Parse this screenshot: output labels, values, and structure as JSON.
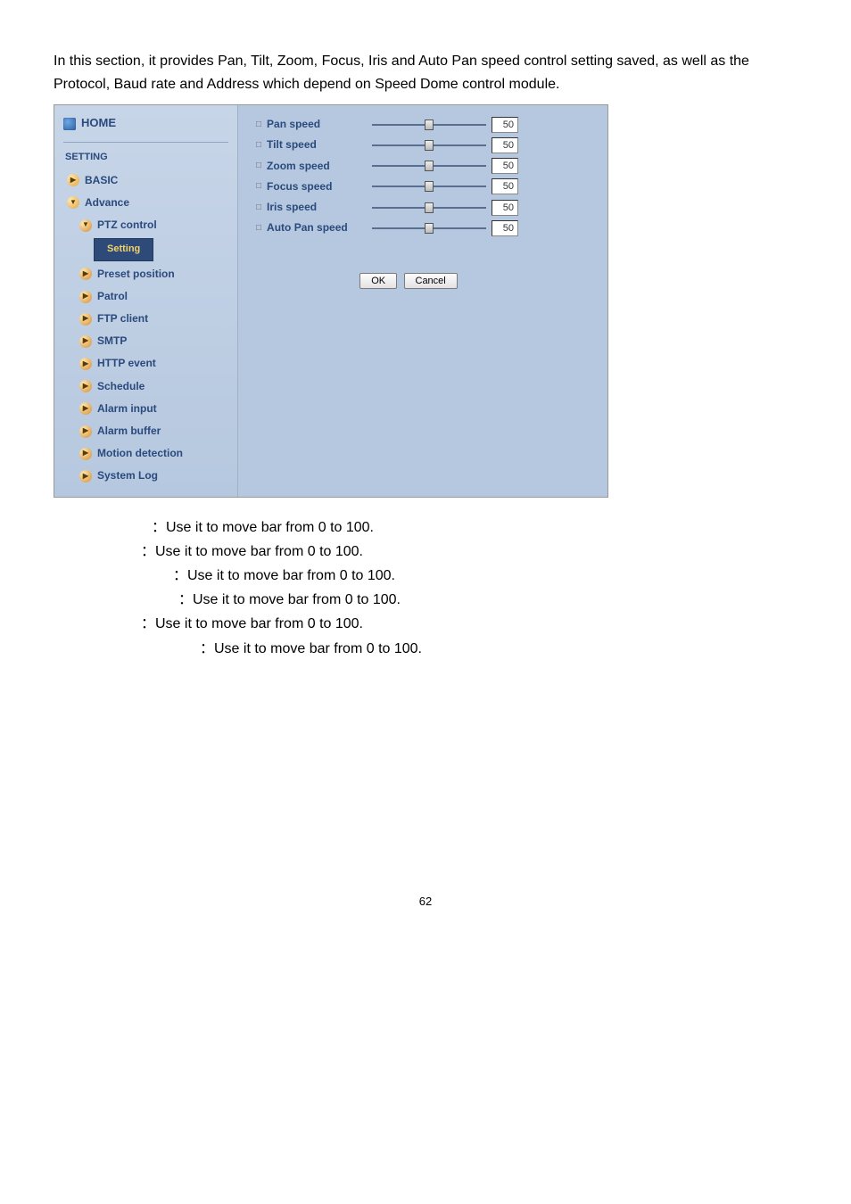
{
  "intro": "    In this section, it provides Pan, Tilt, Zoom, Focus, Iris and Auto Pan speed control setting saved, as well as the Protocol, Baud rate and Address which depend on Speed Dome control module.",
  "sidebar": {
    "home": "HOME",
    "section": "SETTING",
    "basic": "BASIC",
    "advance": "Advance",
    "ptz": "PTZ control",
    "setting": "Setting",
    "items": {
      "preset": "Preset position",
      "patrol": "Patrol",
      "ftp": "FTP client",
      "smtp": "SMTP",
      "http": "HTTP event",
      "schedule": "Schedule",
      "ain": "Alarm input",
      "abuf": "Alarm buffer",
      "motion": "Motion detection",
      "syslog": "System Log"
    }
  },
  "sliders": {
    "pan": {
      "label": "Pan speed",
      "value": "50"
    },
    "tilt": {
      "label": "Tilt speed",
      "value": "50"
    },
    "zoom": {
      "label": "Zoom speed",
      "value": "50"
    },
    "focus": {
      "label": "Focus speed",
      "value": "50"
    },
    "iris": {
      "label": "Iris speed",
      "value": "50"
    },
    "autop": {
      "label": "Auto Pan speed",
      "value": "50"
    }
  },
  "buttons": {
    "ok": "OK",
    "cancel": "Cancel"
  },
  "doc": {
    "l1": "：Use it to move bar from 0 to 100.",
    "l2": "：Use it to move bar from 0 to 100.",
    "l3": "：Use it to move bar from 0 to 100.",
    "l4": "：Use it to move bar from 0 to 100.",
    "l5": "：Use it to move bar from 0 to 100.",
    "l6": "：Use it to move bar from 0 to 100."
  },
  "pagenum": "62"
}
